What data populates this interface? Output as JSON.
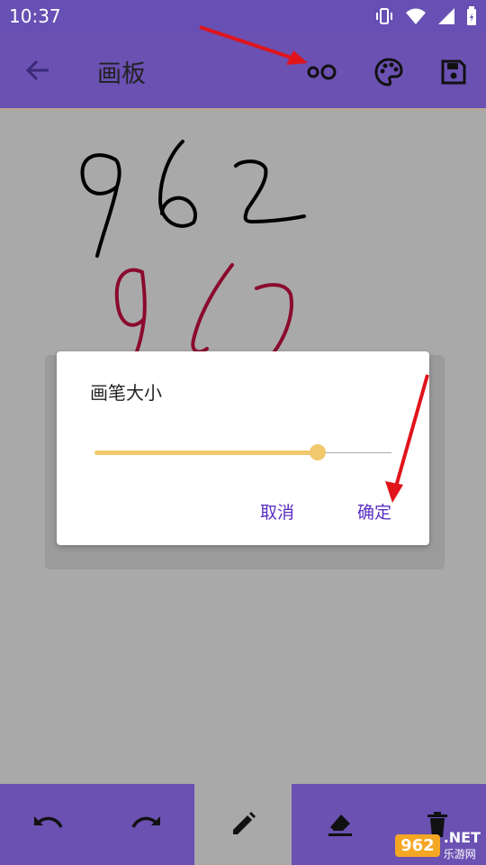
{
  "status": {
    "time": "10:37",
    "icons": [
      "vibrate-icon",
      "wifi-icon",
      "signal-icon",
      "battery-icon"
    ]
  },
  "appbar": {
    "title": "画板",
    "actions": [
      "brush-size-icon",
      "palette-icon",
      "save-icon"
    ]
  },
  "canvas": {
    "drawings": [
      {
        "text": "962",
        "color": "#000000"
      },
      {
        "text": "962",
        "color": "#8b0a2e"
      }
    ]
  },
  "dialog": {
    "title": "画笔大小",
    "slider_value": 0.75,
    "cancel_label": "取消",
    "confirm_label": "确定"
  },
  "toolbar": {
    "tools": [
      "undo-icon",
      "redo-icon",
      "pen-icon",
      "eraser-icon",
      "delete-icon"
    ],
    "selected": "pen-icon"
  },
  "watermark": {
    "logo": "962",
    "net": ".NET",
    "sub": "乐游网"
  },
  "colors": {
    "primary": "#6a51b2",
    "accent": "#f2c86d",
    "button_text": "#5a2ec2",
    "canvas": "#a9a9a9"
  }
}
